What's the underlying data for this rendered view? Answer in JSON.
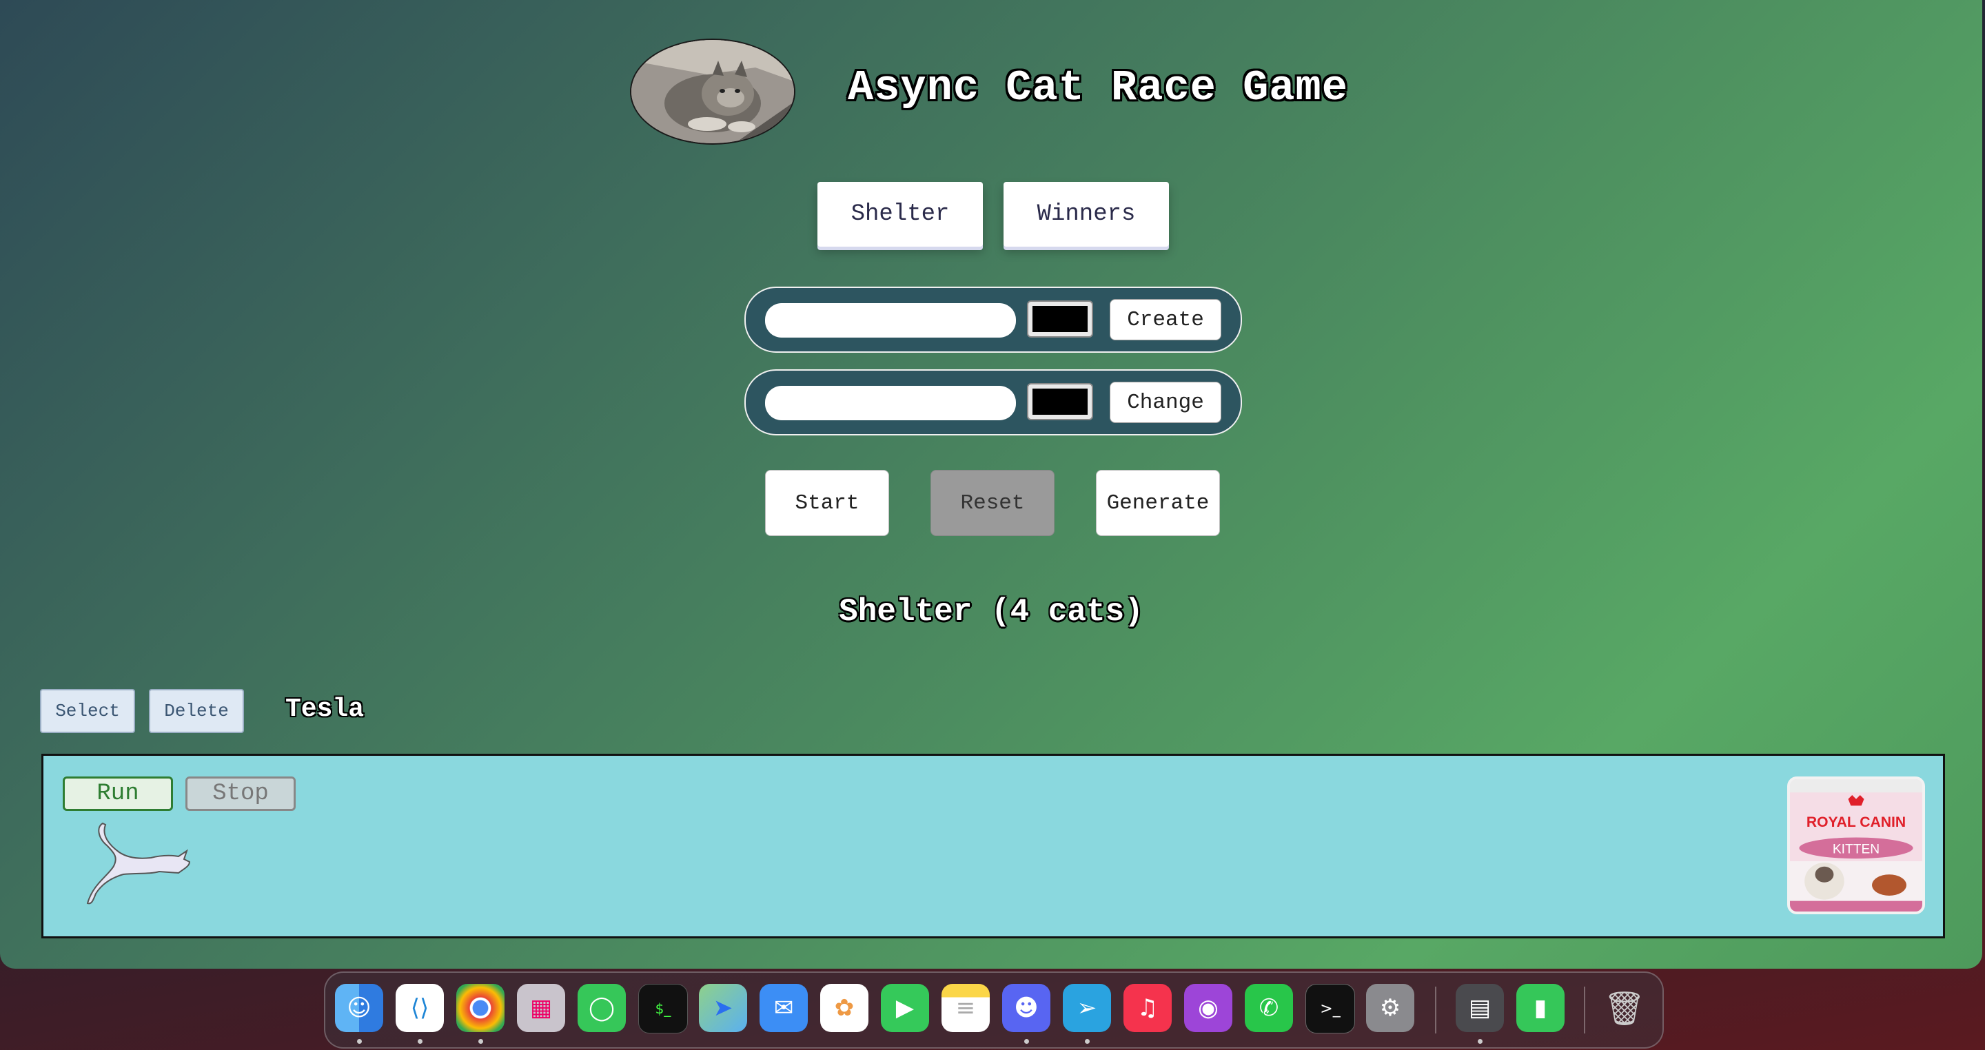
{
  "app": {
    "title": "Async Cat Race Game"
  },
  "nav": {
    "shelter_label": "Shelter",
    "winners_label": "Winners"
  },
  "create_form": {
    "name_value": "",
    "color_value": "#000000",
    "button_label": "Create"
  },
  "update_form": {
    "name_value": "",
    "color_value": "#000000",
    "button_label": "Change"
  },
  "controls": {
    "start_label": "Start",
    "reset_label": "Reset",
    "generate_label": "Generate"
  },
  "shelter": {
    "heading": "Shelter (4 cats)"
  },
  "racer": {
    "select_label": "Select",
    "delete_label": "Delete",
    "name": "Tesla",
    "run_label": "Run",
    "stop_label": "Stop",
    "cat_color": "#e8e6f4"
  },
  "finish": {
    "brand_text": "ROYAL CANIN",
    "product_text": "KITTEN"
  },
  "dock": {
    "apps": [
      "finder-icon",
      "vscode-icon",
      "chrome-icon",
      "launchpad-icon",
      "messages-icon",
      "terminal-icon",
      "maps-icon",
      "mail-icon",
      "photos-icon",
      "facetime-icon",
      "notes-icon",
      "discord-icon",
      "telegram-icon",
      "music-icon",
      "podcasts-icon",
      "whatsapp-icon",
      "iterm-icon",
      "settings-icon",
      "calculator-icon",
      "numbers-icon",
      "trash-icon"
    ]
  }
}
